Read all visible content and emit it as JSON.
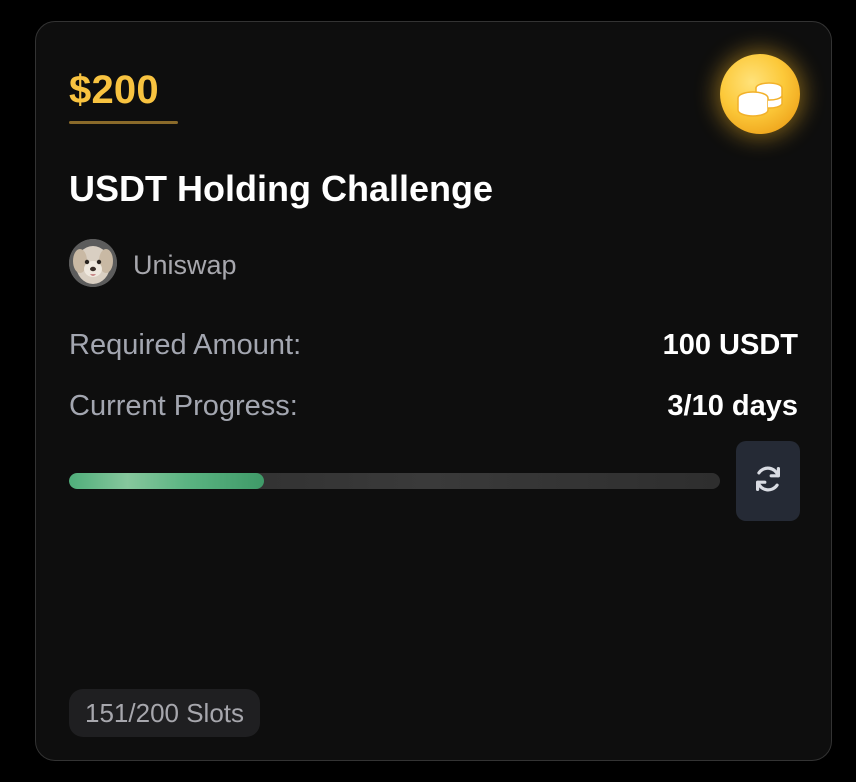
{
  "card": {
    "reward": "$200",
    "title": "USDT Holding Challenge",
    "organizer": {
      "name": "Uniswap"
    },
    "required_amount": {
      "label": "Required Amount:",
      "value": "100 USDT"
    },
    "current_progress": {
      "label": "Current Progress:",
      "value": "3/10 days",
      "fraction": 0.3
    },
    "slots": "151/200 Slots",
    "icons": {
      "reward": "coins-icon",
      "refresh": "refresh-icon"
    },
    "colors": {
      "reward": "#f8c340",
      "progress": "#5bb482",
      "background": "#0e0e0e"
    }
  }
}
